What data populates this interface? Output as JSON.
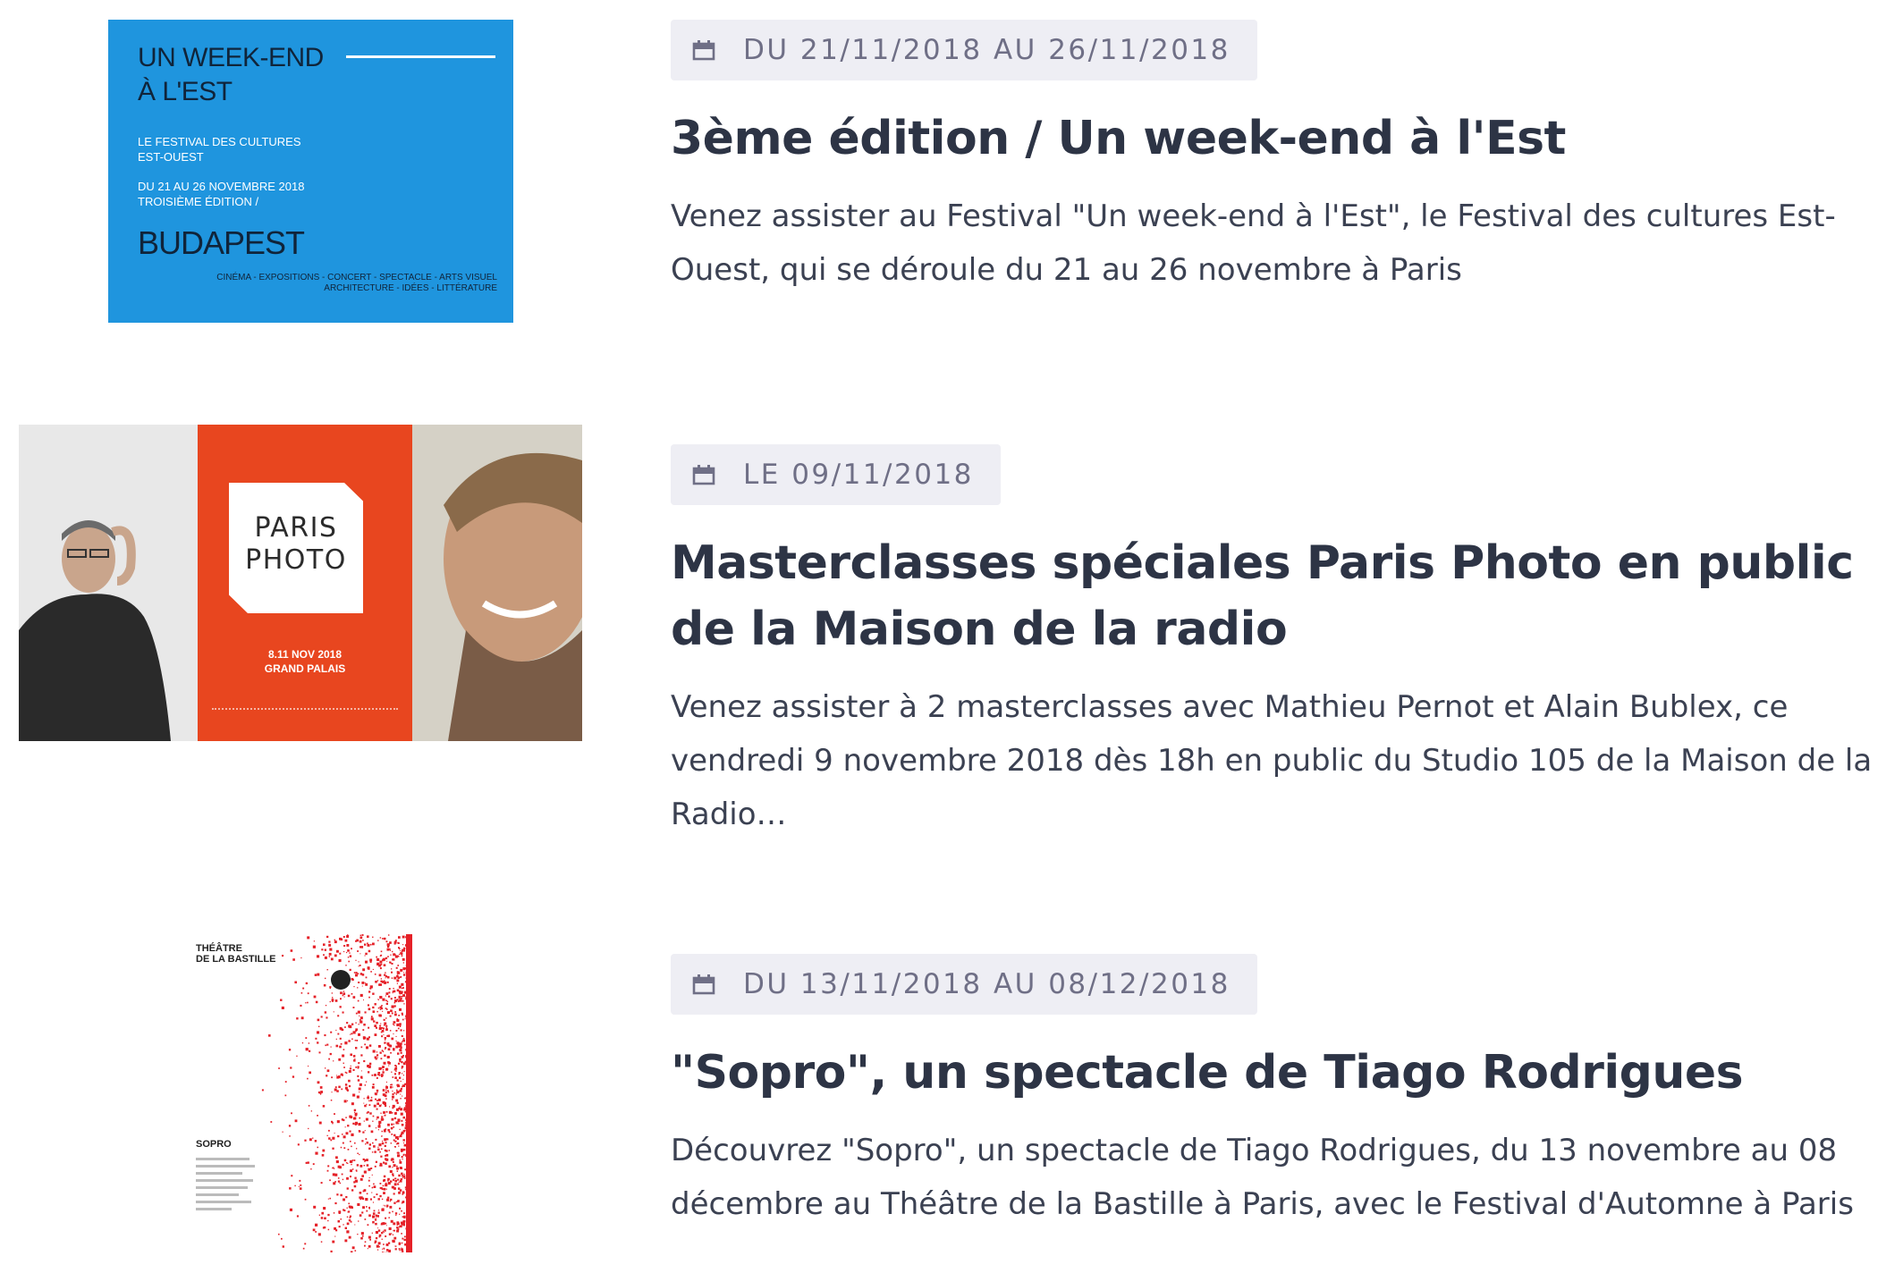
{
  "events": [
    {
      "date": "DU 21/11/2018 AU 26/11/2018",
      "title": "3ème édition / Un week-end à l'Est",
      "description": "Venez assister au Festival \"Un week-end à l'Est\", le Festival des cultures Est-Ouest, qui se déroule du 21 au 26 novembre à Paris",
      "thumbnail": {
        "title": "UN WEEK-END\nÀ L'EST",
        "subtitle": "LE FESTIVAL DES CULTURES\nEST-OUEST",
        "dates": "DU 21 AU 26 NOVEMBRE 2018\nTROISIÈME ÉDITION /",
        "city": "BUDAPEST",
        "footer": "CINÉMA - EXPOSITIONS - CONCERT - SPECTACLE - ARTS VISUEL\nARCHITECTURE - IDÉES - LITTÉRATURE"
      }
    },
    {
      "date": "LE 09/11/2018",
      "title": "Masterclasses spéciales Paris Photo en public de la Maison de la radio",
      "description": "Venez assister à 2 masterclasses avec Mathieu Pernot et Alain Bublex, ce vendredi 9 novembre 2018 dès 18h en public du Studio 105 de la Maison de la Radio…",
      "thumbnail": {
        "logo": "PARIS\nPHOTO",
        "dates": "8.11 NOV 2018\nGRAND PALAIS"
      }
    },
    {
      "date": "DU 13/11/2018 AU 08/12/2018",
      "title": "\"Sopro\", un spectacle de Tiago Rodrigues",
      "description": "Découvrez \"Sopro\", un spectacle de Tiago Rodrigues, du 13 novembre au 08 décembre au Théâtre de la Bastille à Paris, avec le Festival d'Automne à Paris",
      "thumbnail": {
        "header": "THÉÂTRE\nDE LA BASTILLE",
        "title": "SOPRO"
      }
    }
  ],
  "icons": {
    "date": "calendar-icon"
  },
  "colors": {
    "badge_bg": "#eeeef4",
    "badge_text": "#6f6f86",
    "title_text": "#2d3445",
    "body_text": "#3b4152",
    "poster_blue": "#1f95de",
    "poster_orange": "#e8461f",
    "bastille_red": "#e52128"
  }
}
